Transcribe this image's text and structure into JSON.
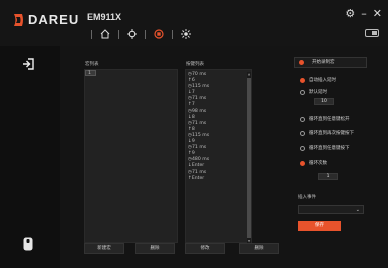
{
  "brand": {
    "logo_text": "DAREU",
    "accent_color": "#e8532c"
  },
  "header": {
    "device_name": "EM911X",
    "nav_icons": [
      "home-icon",
      "crosshair-icon",
      "macro-icon",
      "light-icon"
    ],
    "active_nav": "macro-icon",
    "window_controls": {
      "settings": "⚙",
      "minimize": "–",
      "close": "✕"
    }
  },
  "macro_list": {
    "title": "宏列表",
    "items": [
      "1"
    ]
  },
  "key_list": {
    "title": "按键列表",
    "items": [
      "◷70 ms",
      "↑6",
      "◷115 ms",
      "↓7",
      "◷71 ms",
      "↑7",
      "◷98 ms",
      "↓8",
      "◷71 ms",
      "↑8",
      "◷115 ms",
      "↓9",
      "◷71 ms",
      "↑9",
      "◷480 ms",
      "↓Enter",
      "◷71 ms",
      "↑Enter"
    ]
  },
  "buttons": {
    "new_macro": "新建宏",
    "delete_macro": "删除",
    "modify": "修改",
    "delete_key": "删除"
  },
  "right_panel": {
    "start_record": "开始录制宏",
    "auto_insert_delay": "自动插入延时",
    "default_delay": "默认延时",
    "default_delay_value": "10",
    "loop_until_release": "循环直到任意键松开",
    "loop_until_press_again": "循环直到再次按键按下",
    "loop_until_any_key": "循环直到任意键按下",
    "loop_count": "循环次数",
    "loop_count_value": "1",
    "insert_action": "插入事件",
    "save": "保存"
  }
}
